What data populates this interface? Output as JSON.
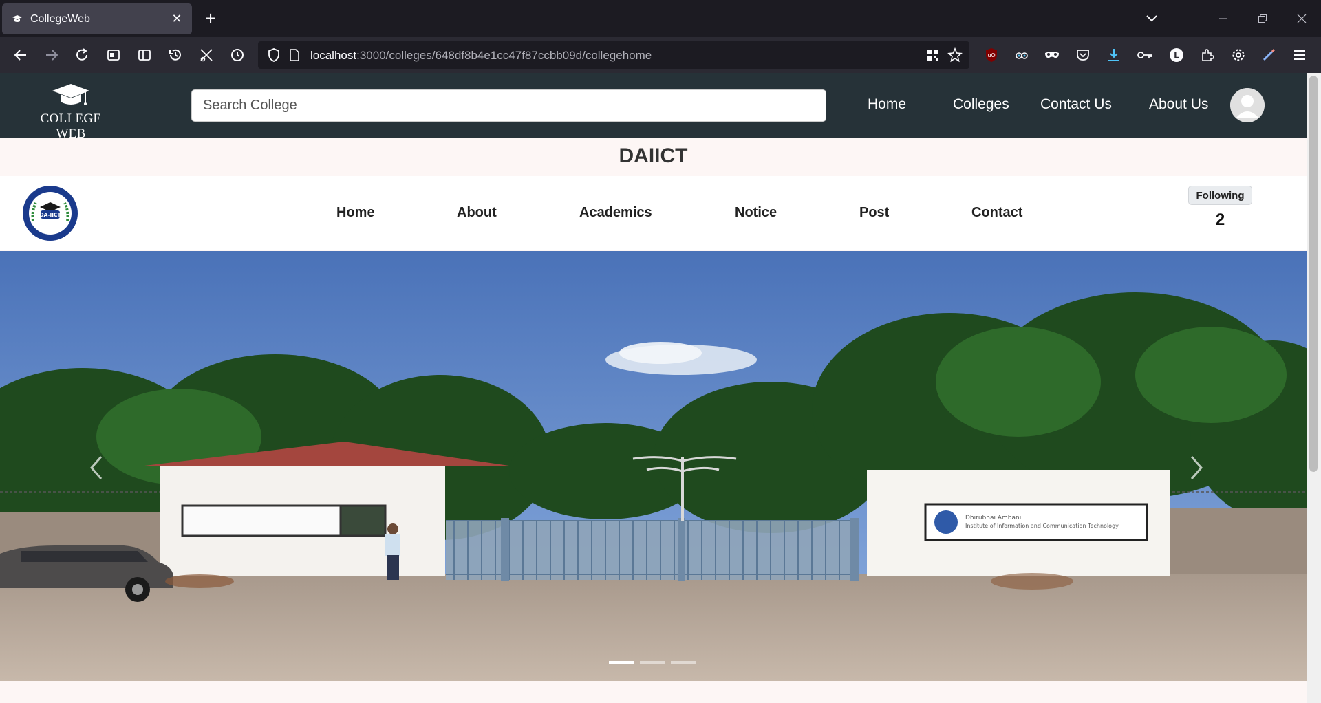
{
  "browser": {
    "tab_title": "CollegeWeb",
    "url_host": "localhost",
    "url_rest": ":3000/colleges/648df8b4e1cc47f87ccbb09d/collegehome"
  },
  "site": {
    "brand": "COLLEGE WEB",
    "search_placeholder": "Search College",
    "nav": [
      "Home",
      "Colleges",
      "Contact Us",
      "About Us"
    ]
  },
  "college": {
    "name": "DAIICT",
    "logo_text": "DA-IICT",
    "nav": [
      "Home",
      "About",
      "Academics",
      "Notice",
      "Post",
      "Contact"
    ],
    "follow_label": "Following",
    "followers": "2"
  },
  "carousel": {
    "slide_count": 3,
    "active_index": 0,
    "sign_text_1": "Dhirubhai Ambani",
    "sign_text_2": "Institute of Information and Communication Technology"
  }
}
